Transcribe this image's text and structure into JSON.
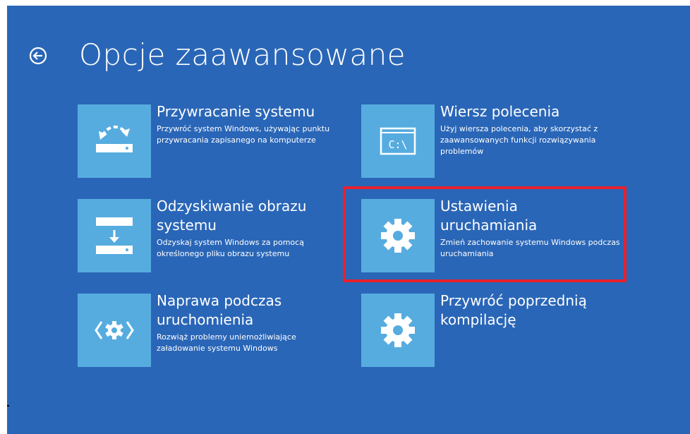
{
  "page": {
    "title": "Opcje zaawansowane"
  },
  "colors": {
    "background": "#2a66b7",
    "tile": "#56acdf",
    "highlight": "#e8212c",
    "text": "#ffffff"
  },
  "options": [
    {
      "title": "Przywracanie systemu",
      "description": "Przywróć system Windows, używając punktu przywracania zapisanego na komputerze",
      "icon": "system-restore-icon"
    },
    {
      "title": "Wiersz polecenia",
      "description": "Użyj wiersza polecenia, aby skorzystać z zaawansowanych funkcji rozwiązywania problemów",
      "icon": "command-prompt-icon",
      "icon_text": "C:\\"
    },
    {
      "title": "Odzyskiwanie obrazu systemu",
      "description": "Odzyskaj system Windows za pomocą określonego pliku obrazu systemu",
      "icon": "system-image-recovery-icon"
    },
    {
      "title": "Ustawienia uruchamiania",
      "description": "Zmień zachowanie systemu Windows podczas uruchamiania",
      "icon": "gear-icon"
    },
    {
      "title": "Naprawa podczas uruchomienia",
      "description": "Rozwiąż problemy uniemożliwiające załadowanie systemu Windows",
      "icon": "startup-repair-icon"
    },
    {
      "title": "Przywróć poprzednią kompilację",
      "description": "",
      "icon": "gear-icon"
    }
  ],
  "highlighted_option": "Ustawienia uruchamiania"
}
